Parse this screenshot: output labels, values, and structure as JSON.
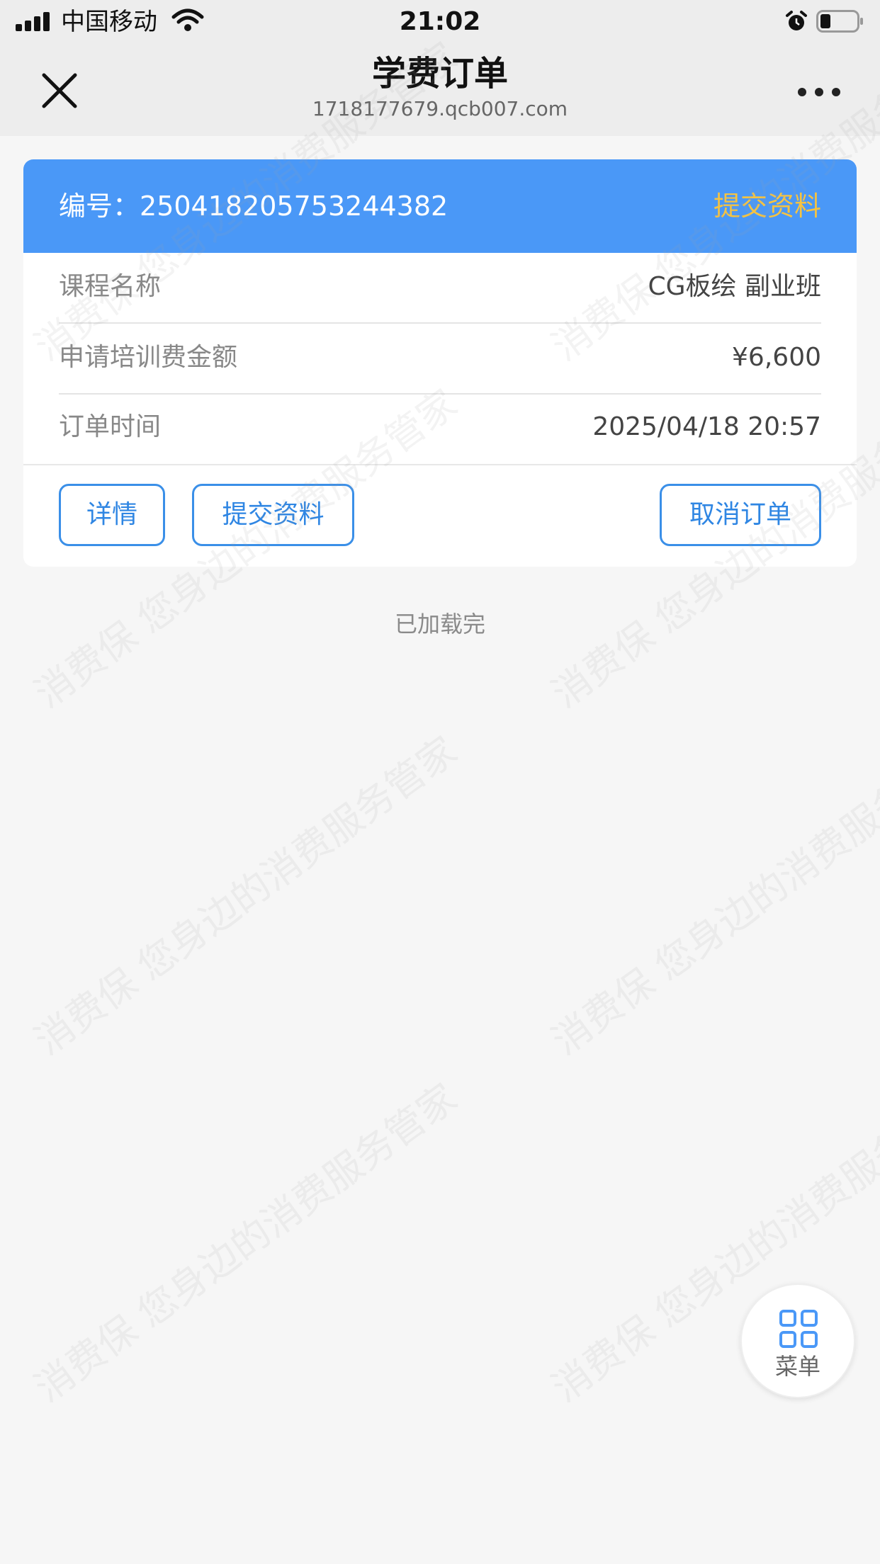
{
  "status_bar": {
    "carrier": "中国移动",
    "time": "21:02"
  },
  "nav": {
    "title": "学费订单",
    "url": "1718177679.qcb007.com"
  },
  "order": {
    "number_label": "编号：",
    "number": "250418205753244382",
    "status": "提交资料",
    "rows": [
      {
        "label": "课程名称",
        "value": "CG板绘 副业班"
      },
      {
        "label": "申请培训费金额",
        "value": "¥6,600"
      },
      {
        "label": "订单时间",
        "value": "2025/04/18 20:57"
      }
    ],
    "buttons": {
      "details": "详情",
      "submit": "提交资料",
      "cancel": "取消订单"
    }
  },
  "footer": {
    "loaded_text": "已加载完"
  },
  "menu_fab": {
    "label": "菜单"
  },
  "watermark": {
    "text": "消费保 您身边的消费服务管家"
  },
  "colors": {
    "header_blue": "#4a98f7",
    "status_yellow": "#f5c342",
    "button_blue": "#3a8fe8"
  }
}
